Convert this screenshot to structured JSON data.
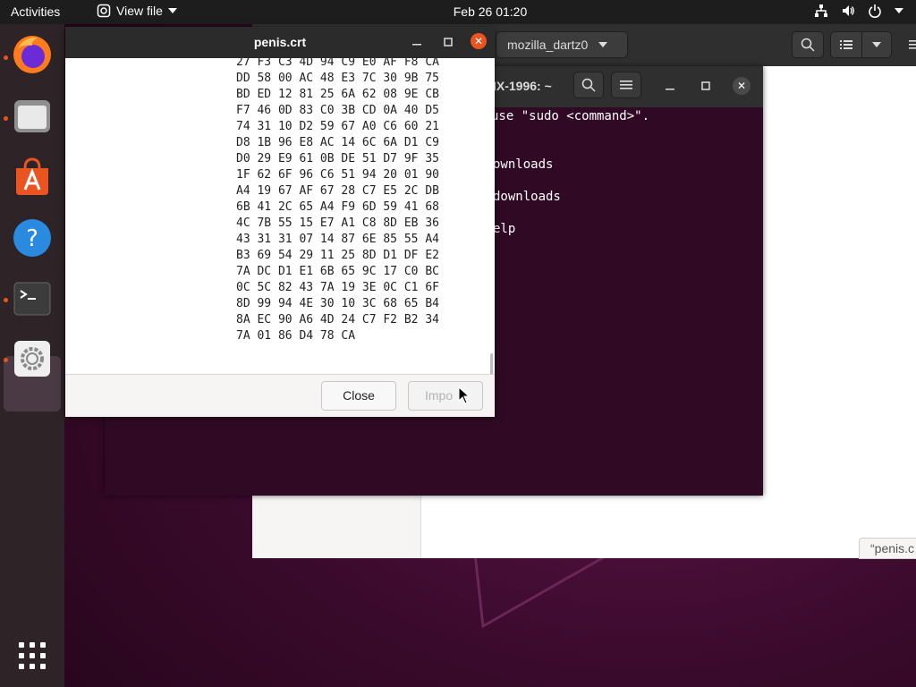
{
  "topbar": {
    "activities": "Activities",
    "app_menu": "View file",
    "clock": "Feb 26  01:20"
  },
  "files_window": {
    "path_button": "mozilla_dartz0",
    "status_text": "“penis.c"
  },
  "terminal": {
    "title": "IX-1996: ~",
    "lines": [
      "use \"sudo <command>\".",
      "ownloads",
      "downloads",
      "elp"
    ]
  },
  "dialog": {
    "title": "penis.crt",
    "hex_lines": [
      "27 F3 C3 4D 94 C9 E0 AF F8 CA",
      "DD 58 00 AC 48 E3 7C 30 9B 75",
      "BD ED 12 81 25 6A 62 08 9E CB",
      "F7 46 0D 83 C0 3B CD 0A 40 D5",
      "74 31 10 D2 59 67 A0 C6 60 21",
      "D8 1B 96 E8 AC 14 6C 6A D1 C9",
      "D0 29 E9 61 0B DE 51 D7 9F 35",
      "1F 62 6F 96 C6 51 94 20 01 90",
      "A4 19 67 AF 67 28 C7 E5 2C DB",
      "6B 41 2C 65 A4 F9 6D 59 41 68",
      "4C 7B 55 15 E7 A1 C8 8D EB 36",
      "43 31 31 07 14 87 6E 85 55 A4",
      "B3 69 54 29 11 25 8D D1 DF E2",
      "7A DC D1 E1 6B 65 9C 17 C0 BC",
      "0C 5C 82 43 7A 19 3E 0C C1 6F",
      "8D 99 94 4E 30 10 3C 68 65 B4",
      "8A EC 90 A6 4D 24 C7 F2 B2 34",
      "7A 01 86 D4 78 CA"
    ],
    "close_label": "Close",
    "import_label": "Impo"
  },
  "colors": {
    "accent": "#e95420",
    "terminal_bg": "#300a24",
    "topbar_bg": "#1d1d1d"
  },
  "icons": [
    "network-icon",
    "volume-icon",
    "power-icon",
    "firefox-icon",
    "files-icon",
    "software-icon",
    "help-icon",
    "terminal-icon",
    "settings-icon",
    "app-grid-icon"
  ]
}
